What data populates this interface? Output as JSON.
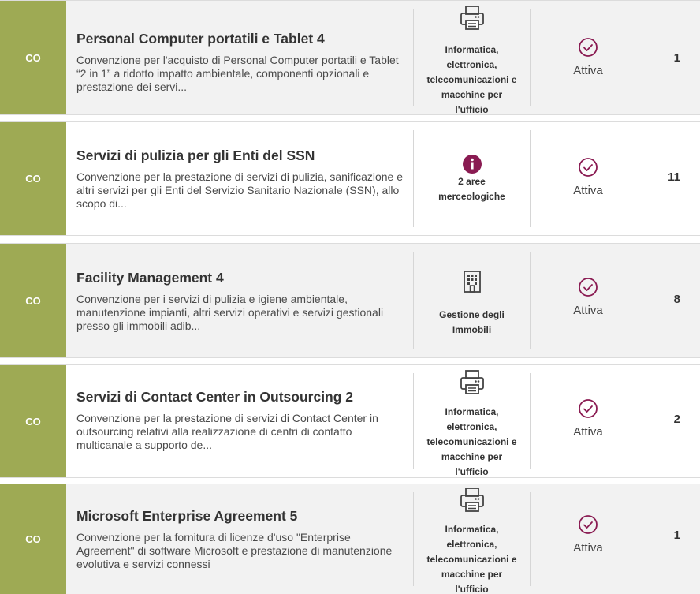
{
  "colors": {
    "badge_bg": "#9eaa54",
    "accent_maroon": "#8a1b52",
    "row_gray": "#f2f2f2",
    "row_white": "#ffffff"
  },
  "items": [
    {
      "badge": "CO",
      "title": "Personal Computer portatili e Tablet 4",
      "description": "Convenzione per l'acquisto di Personal Computer portatili e Tablet “2 in 1” a ridotto impatto ambientale, componenti opzionali e prestazione dei servi...",
      "category_icon": "printer-icon",
      "category_lines": [
        "Informatica,",
        "elettronica,",
        "telecomunicazioni e",
        "macchine per",
        "l'ufficio"
      ],
      "status": "Attiva",
      "count": "1"
    },
    {
      "badge": "CO",
      "title": "Servizi di pulizia per gli Enti del SSN",
      "description": "Convenzione per la prestazione di servizi di pulizia, sanificazione e altri servizi per gli Enti del Servizio Sanitario Nazionale (SSN), allo scopo di...",
      "category_icon": "info-icon",
      "category_lines": [
        "2 aree",
        "merceologiche"
      ],
      "status": "Attiva",
      "count": "11"
    },
    {
      "badge": "CO",
      "title": "Facility Management 4",
      "description": "Convenzione per i servizi di pulizia e igiene ambientale, manutenzione impianti, altri servizi operativi e servizi gestionali presso gli immobili adib...",
      "category_icon": "building-icon",
      "category_lines": [
        "Gestione degli",
        "Immobili"
      ],
      "status": "Attiva",
      "count": "8"
    },
    {
      "badge": "CO",
      "title": "Servizi di Contact Center in Outsourcing 2",
      "description": "Convenzione per la prestazione di servizi di Contact Center in outsourcing relativi alla realizzazione di centri di contatto multicanale a supporto de...",
      "category_icon": "printer-icon",
      "category_lines": [
        "Informatica,",
        "elettronica,",
        "telecomunicazioni e",
        "macchine per",
        "l'ufficio"
      ],
      "status": "Attiva",
      "count": "2"
    },
    {
      "badge": "CO",
      "title": "Microsoft Enterprise Agreement 5",
      "description": "Convenzione per la fornitura di licenze d'uso \"Enterprise Agreement\" di software Microsoft e prestazione di manutenzione evolutiva e servizi connessi",
      "category_icon": "printer-icon",
      "category_lines": [
        "Informatica,",
        "elettronica,",
        "telecomunicazioni e",
        "macchine per",
        "l'ufficio"
      ],
      "status": "Attiva",
      "count": "1"
    }
  ]
}
